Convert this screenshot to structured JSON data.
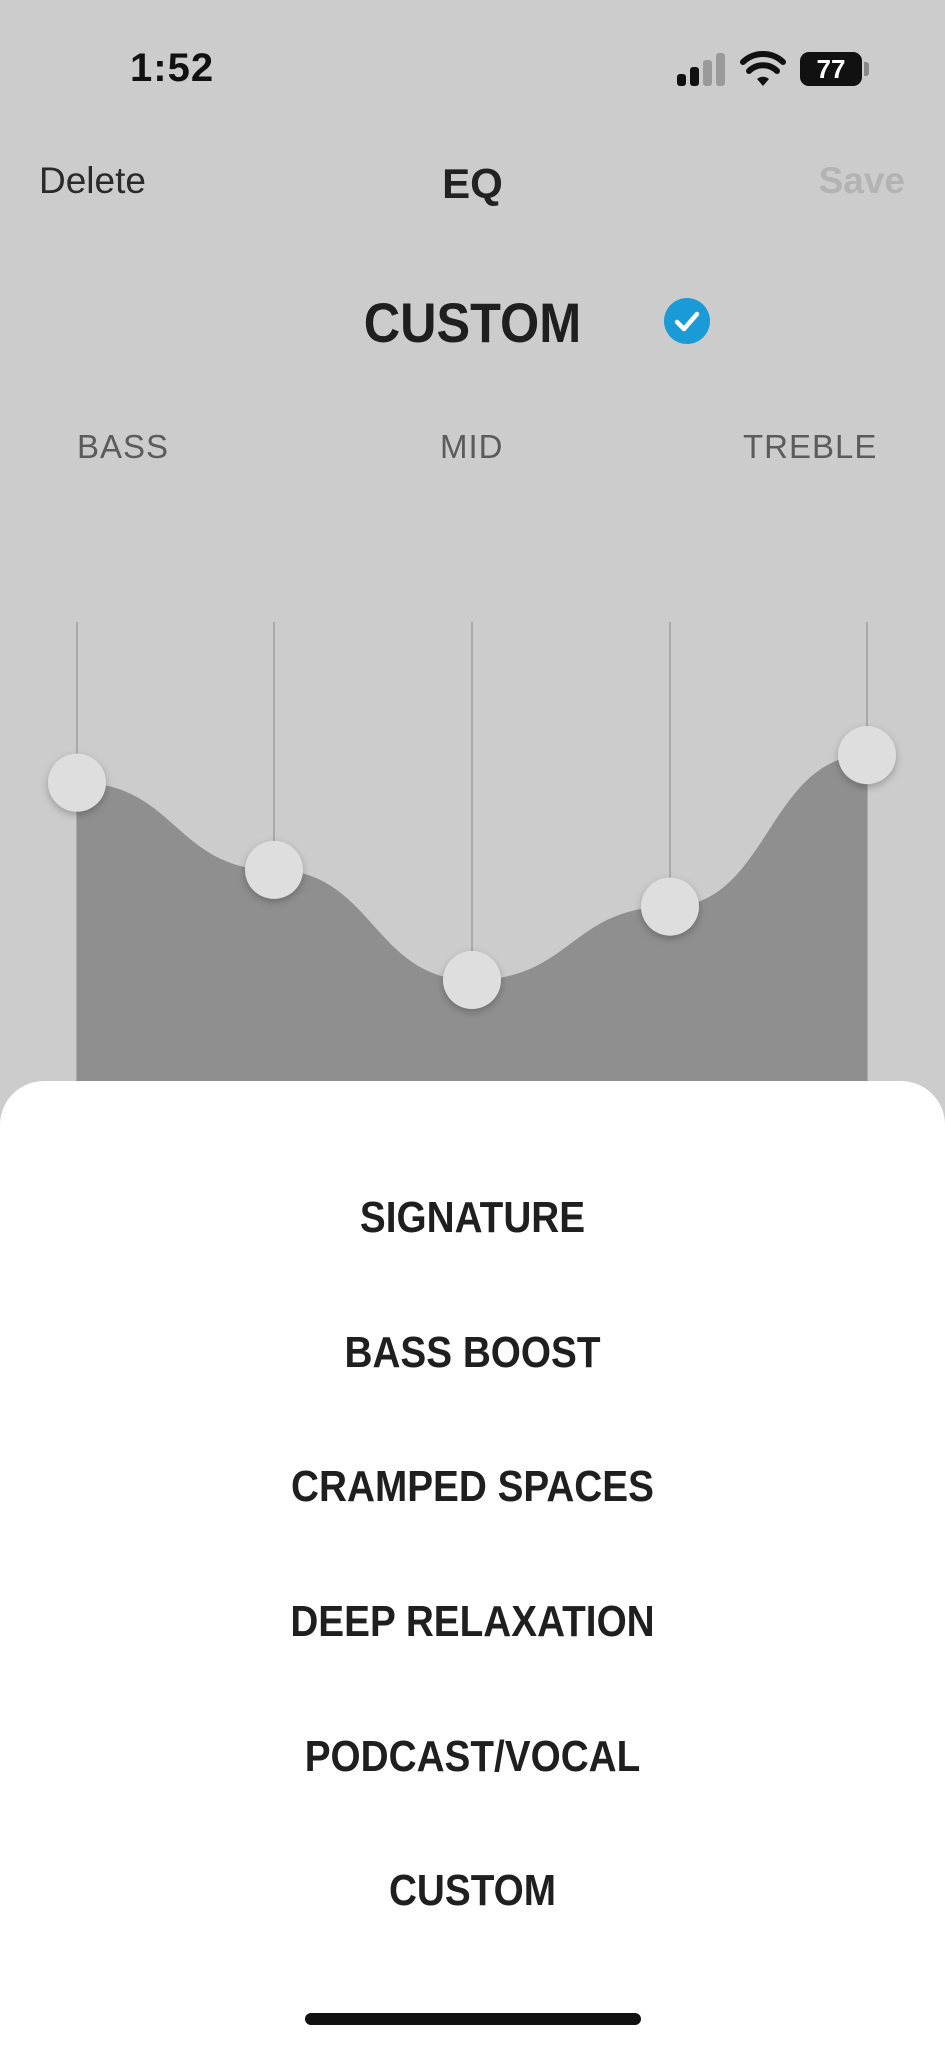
{
  "status_bar": {
    "time": "1:52",
    "battery": "77"
  },
  "nav": {
    "delete_label": "Delete",
    "title": "EQ",
    "save_label": "Save"
  },
  "preset": {
    "current": "CUSTOM",
    "selected_color": "#1a9ad6"
  },
  "bands": {
    "bass": "BASS",
    "mid": "MID",
    "treble": "TREBLE"
  },
  "eq_levels": [
    0.35,
    0.54,
    0.78,
    0.62,
    0.29
  ],
  "presets": [
    {
      "label": "SIGNATURE"
    },
    {
      "label": "BASS BOOST"
    },
    {
      "label": "CRAMPED SPACES"
    },
    {
      "label": "DEEP RELAXATION"
    },
    {
      "label": "PODCAST/VOCAL"
    },
    {
      "label": "CUSTOM"
    }
  ]
}
